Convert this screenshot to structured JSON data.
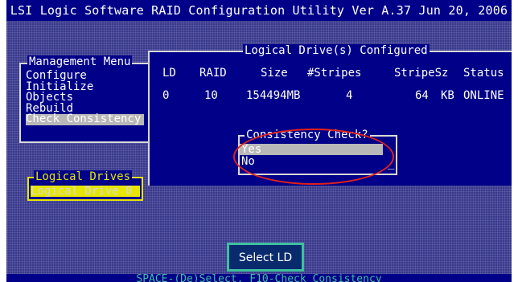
{
  "title": "LSI Logic Software RAID Configuration Utility Ver A.37 Jun 20, 2006",
  "management_menu": {
    "title": "Management Menu",
    "items": [
      "Configure",
      "Initialize",
      "Objects",
      "Rebuild",
      "Check Consistency"
    ],
    "selected_index": 4
  },
  "logical_drives_panel": {
    "title": "Logical Drive(s) Configured",
    "columns": {
      "ld": "LD",
      "raid": "RAID",
      "size": "Size",
      "stripes": "#Stripes",
      "stripesz": "StripeSz",
      "status": "Status"
    },
    "row": {
      "ld": "0",
      "raid": "10",
      "size": "154494MB",
      "stripes": "4",
      "stripesz": "64",
      "stripesz_unit": "KB",
      "status": "ONLINE"
    }
  },
  "dialog": {
    "title": "Consistency Check?",
    "options": [
      "Yes",
      "No"
    ],
    "selected": "Yes",
    "cursor": "_"
  },
  "logical_drives_list": {
    "title": "Logical Drives",
    "items": [
      "Logical Drive 0"
    ]
  },
  "select_button": "Select LD",
  "status_bar": "SPACE-(De)Select, F10-Check Consistency",
  "colors": {
    "background": "#3a3a8c",
    "panel": "#000088",
    "highlight_ring": "#e0221b",
    "accent_yellow": "#e6e600",
    "accent_teal": "#3fbfa0"
  }
}
